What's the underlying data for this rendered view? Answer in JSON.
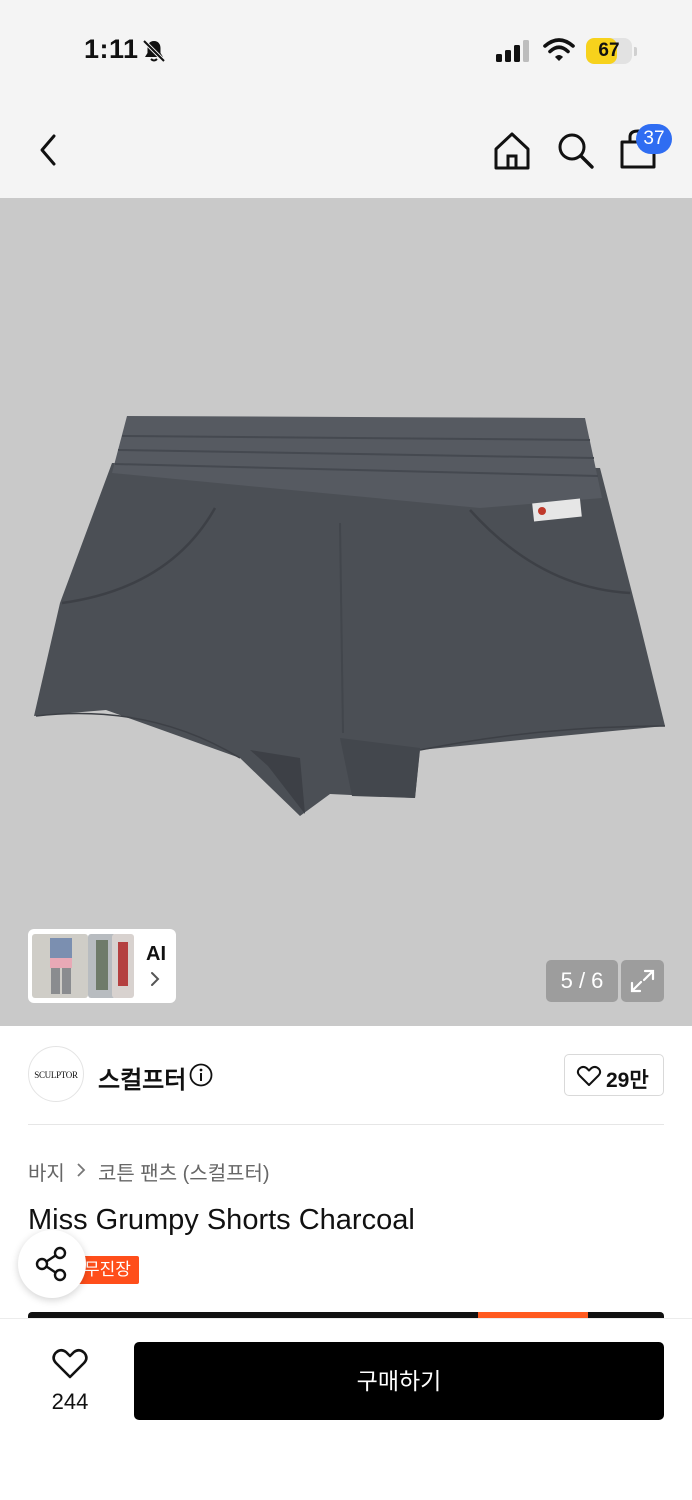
{
  "status_bar": {
    "time": "1:11",
    "battery": "67",
    "battery_level": 0.67,
    "icons": [
      "bell-slash-icon",
      "cellular-signal-icon",
      "wifi-icon",
      "battery-icon"
    ]
  },
  "nav": {
    "icons": [
      "chevron-left-icon",
      "home-icon",
      "search-icon",
      "shopping-bag-icon"
    ],
    "cart_count": "37"
  },
  "gallery": {
    "ai_label": "AI",
    "page_indicator": "5 / 6",
    "colors": {
      "background": "#c9c9c9",
      "shorts": "#4b4f55"
    }
  },
  "brand": {
    "logo_text": "SCULPTOR",
    "name": "스컬프터",
    "like_count": "29만"
  },
  "product": {
    "breadcrumb": [
      "바지",
      "코튼 팬츠 (스컬프터)"
    ],
    "title": "Miss Grumpy Shorts Charcoal",
    "tag": "무진장"
  },
  "bottom_bar": {
    "wish_count": "244",
    "buy_label": "구매하기"
  },
  "colors": {
    "accent_blue": "#2f6df2",
    "tag_orange": "#ff4e1a",
    "battery_yellow": "#f7d21c"
  }
}
